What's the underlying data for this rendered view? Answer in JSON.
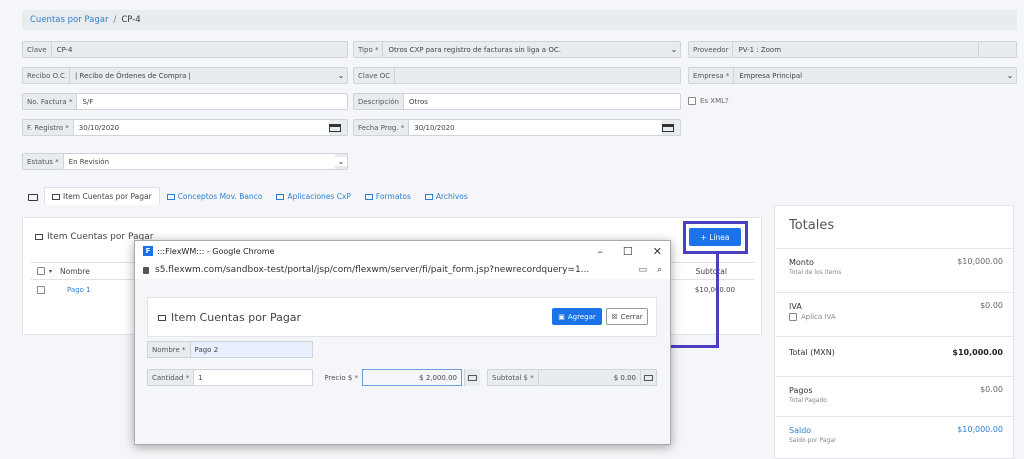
{
  "breadcrumb": {
    "link": "Cuentas por Pagar",
    "separator": "/",
    "current": "CP-4"
  },
  "form": {
    "clave": {
      "label": "Clave",
      "value": "CP-4"
    },
    "tipo": {
      "label": "Tipo *",
      "value": "Otros CXP para registro de facturas sin liga a OC."
    },
    "proveedor": {
      "label": "Proveedor",
      "value": "PV-1 : Zoom"
    },
    "recibo": {
      "label": "Recibo O.C",
      "value": "| Recibo de Órdenes de Compra |"
    },
    "clave_oc": {
      "label": "Clave OC",
      "value": ""
    },
    "empresa": {
      "label": "Empresa *",
      "value": "Empresa Principal"
    },
    "factura": {
      "label": "No. Factura *",
      "value": "S/F"
    },
    "descripcion": {
      "label": "Descripción",
      "value": "Otros"
    },
    "es_xml": {
      "label": "Es XML?"
    },
    "registro": {
      "label": "F. Registro *",
      "value": "30/10/2020"
    },
    "fecha_prog": {
      "label": "Fecha Prog. *",
      "value": "30/10/2020"
    },
    "estatus": {
      "label": "Estatus *",
      "value": "En Revisión"
    }
  },
  "tabs": [
    "Item Cuentas por Pagar",
    "Conceptos Mov. Banco",
    "Aplicaciones CxP",
    "Formatos",
    "Archivos"
  ],
  "card": {
    "title": "Item Cuentas por Pagar",
    "columns": {
      "name": "Nombre",
      "subtotal": "Subtotal"
    },
    "rows": [
      {
        "name": "Pago 1",
        "subtotal": "$10,000.00"
      }
    ],
    "add_button": "+ Línea"
  },
  "totals": {
    "title": "Totales",
    "monto": {
      "label": "Monto",
      "sub": "Total de los items",
      "amount": "$10,000.00"
    },
    "iva": {
      "label": "IVA",
      "sub": "Aplica IVA",
      "amount": "$0.00"
    },
    "total": {
      "label": "Total (MXN)",
      "amount": "$10,000.00"
    },
    "pagos": {
      "label": "Pagos",
      "sub": "Total Pagado",
      "amount": "$0.00"
    },
    "saldo": {
      "label": "Saldo",
      "sub": "Saldo por Pagar",
      "amount": "$10,000.00"
    }
  },
  "popup": {
    "window_title": ":::FlexWM::: - Google Chrome",
    "url": "s5.flexwm.com/sandbox-test/portal/jsp/com/flexwm/server/fi/pait_form.jsp?newrecordquery=1...",
    "title": "Item Cuentas por Pagar",
    "agregar": "Agregar",
    "cerrar": "Cerrar",
    "nombre": {
      "label": "Nombre *",
      "value": "Pago 2"
    },
    "cantidad": {
      "label": "Cantidad *",
      "value": "1"
    },
    "precio": {
      "label": "Precio $ *",
      "value": "$ 2,000.00"
    },
    "subtotal": {
      "label": "Subtotal $ *",
      "value": "$ 0.00"
    }
  },
  "colors": {
    "accent": "#1a73e8",
    "link": "#2f7fd1",
    "highlight": "#4b3fc1"
  }
}
